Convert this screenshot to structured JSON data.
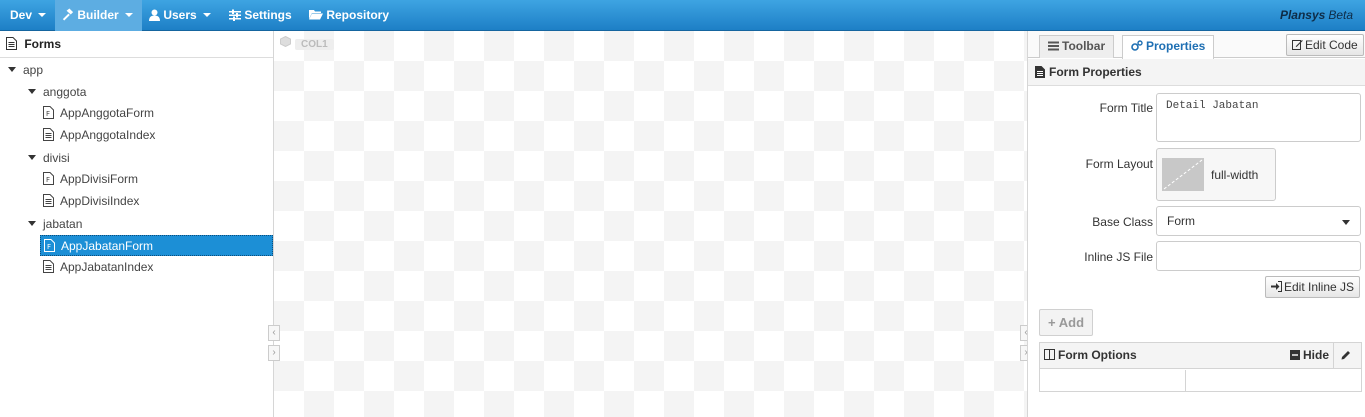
{
  "topbar": {
    "items": [
      {
        "label": "Dev",
        "icon": "none",
        "dropdown": true
      },
      {
        "label": "Builder",
        "icon": "hammer-icon",
        "dropdown": true,
        "active": true
      },
      {
        "label": "Users",
        "icon": "user-icon",
        "dropdown": true
      },
      {
        "label": "Settings",
        "icon": "sliders-icon",
        "dropdown": false
      },
      {
        "label": "Repository",
        "icon": "folder-open-icon",
        "dropdown": false
      }
    ],
    "brand": "Plansys",
    "brand_suffix": "Beta"
  },
  "left_panel": {
    "title": "Forms",
    "tree": {
      "root": "app",
      "folders": [
        {
          "name": "anggota",
          "files": [
            "AppAnggotaForm",
            "AppAnggotaIndex"
          ]
        },
        {
          "name": "divisi",
          "files": [
            "AppDivisiForm",
            "AppDivisiIndex"
          ]
        },
        {
          "name": "jabatan",
          "files": [
            "AppJabatanForm",
            "AppJabatanIndex"
          ]
        }
      ],
      "selected": "AppJabatanForm"
    }
  },
  "canvas": {
    "col_label": "COL1"
  },
  "right_panel": {
    "tabs": [
      "Toolbar",
      "Properties"
    ],
    "active_tab": "Properties",
    "edit_code_label": "Edit Code",
    "section_title": "Form Properties",
    "fields": {
      "form_title_label": "Form Title",
      "form_title_value": "Detail Jabatan",
      "form_layout_label": "Form Layout",
      "form_layout_value": "full-width",
      "base_class_label": "Base Class",
      "base_class_value": "Form",
      "inline_js_label": "Inline JS File",
      "inline_js_value": ""
    },
    "edit_inline_js_label": "Edit Inline JS",
    "add_label": "Add",
    "options": {
      "title": "Form Options",
      "hide_label": "Hide"
    }
  },
  "colors": {
    "topbar": "#1d7fc6",
    "selected": "#1c8fd6",
    "active_tab_text": "#1e6fb3"
  }
}
